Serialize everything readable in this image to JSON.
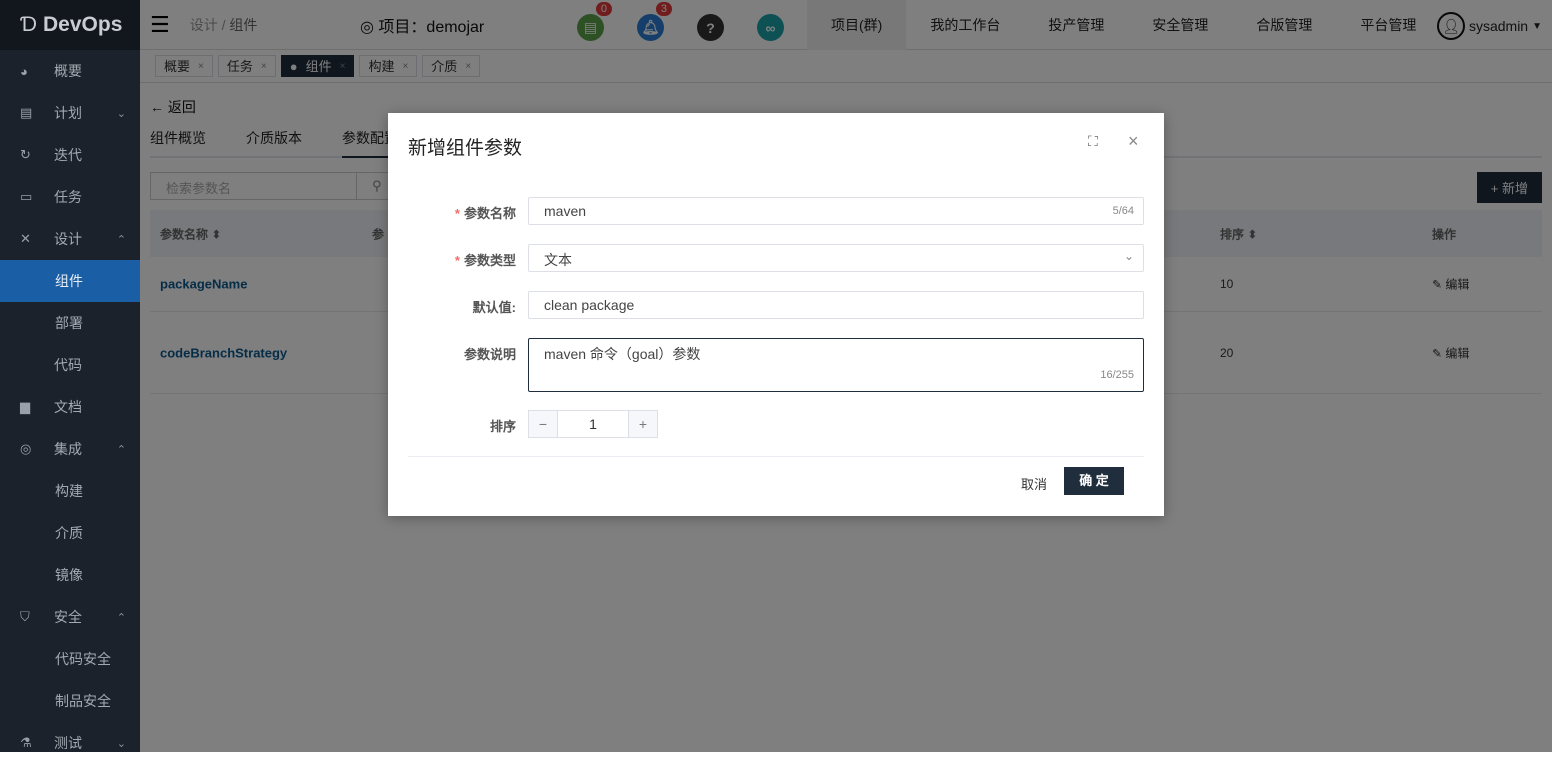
{
  "app": {
    "logo": "DevOps"
  },
  "sidebar": {
    "items": [
      {
        "label": "概要",
        "icon": "dashboard-icon",
        "ic": "◕"
      },
      {
        "label": "计划",
        "icon": "plan-icon",
        "ic": "▤",
        "chev": "⌄"
      },
      {
        "label": "迭代",
        "icon": "iteration-icon",
        "ic": "↻"
      },
      {
        "label": "任务",
        "icon": "task-icon",
        "ic": "▭"
      },
      {
        "label": "设计",
        "icon": "design-icon",
        "ic": "✕",
        "chev": "⌃"
      },
      {
        "label": "组件",
        "sub": true,
        "active": true
      },
      {
        "label": "部署",
        "sub": true
      },
      {
        "label": "代码",
        "icon": "code-icon",
        "ic": "</>"
      },
      {
        "label": "文档",
        "icon": "doc-icon",
        "ic": "▆"
      },
      {
        "label": "集成",
        "icon": "integration-icon",
        "ic": "◎",
        "chev": "⌃"
      },
      {
        "label": "构建",
        "sub": true
      },
      {
        "label": "介质",
        "sub": true
      },
      {
        "label": "镜像",
        "sub": true
      },
      {
        "label": "安全",
        "icon": "shield-icon",
        "ic": "⛉",
        "chev": "⌃"
      },
      {
        "label": "代码安全",
        "sub": true
      },
      {
        "label": "制品安全",
        "sub": true
      },
      {
        "label": "测试",
        "icon": "flask-icon",
        "ic": "⚗",
        "chev": "⌄"
      }
    ]
  },
  "header": {
    "breadcrumb": [
      "设计",
      "组件"
    ],
    "project": "项目：demojar",
    "badges": {
      "docs": "0",
      "notifications": "3"
    },
    "nav": [
      "项目(群)",
      "我的工作台",
      "投产管理",
      "安全管理",
      "合版管理",
      "平台管理"
    ],
    "user": "sysadmin"
  },
  "tabs": [
    {
      "label": "概要"
    },
    {
      "label": "任务"
    },
    {
      "label": "组件",
      "active": true
    },
    {
      "label": "构建"
    },
    {
      "label": "介质"
    }
  ],
  "page": {
    "back": "返回",
    "subtabs": [
      "组件概览",
      "介质版本",
      "参数配置"
    ],
    "search_placeholder": "检索参数名",
    "add": "+ 新增",
    "columns": {
      "name": "参数名称 ⬍",
      "type": "参",
      "order": "排序 ⬍",
      "action": "操作"
    },
    "rows": [
      {
        "name": "packageName",
        "order": "10",
        "action": "编辑"
      },
      {
        "name": "codeBranchStrategy",
        "order": "20",
        "action": "编辑"
      }
    ]
  },
  "modal": {
    "title": "新增组件参数",
    "fields": {
      "name_label": "参数名称",
      "name_value": "maven",
      "name_count": "5/64",
      "type_label": "参数类型",
      "type_value": "文本",
      "default_label": "默认值:",
      "default_value": "clean package",
      "desc_label": "参数说明",
      "desc_value": "maven 命令（goal）参数",
      "desc_count": "16/255",
      "order_label": "排序",
      "order_value": "1"
    },
    "cancel": "取消",
    "ok": "确 定"
  }
}
